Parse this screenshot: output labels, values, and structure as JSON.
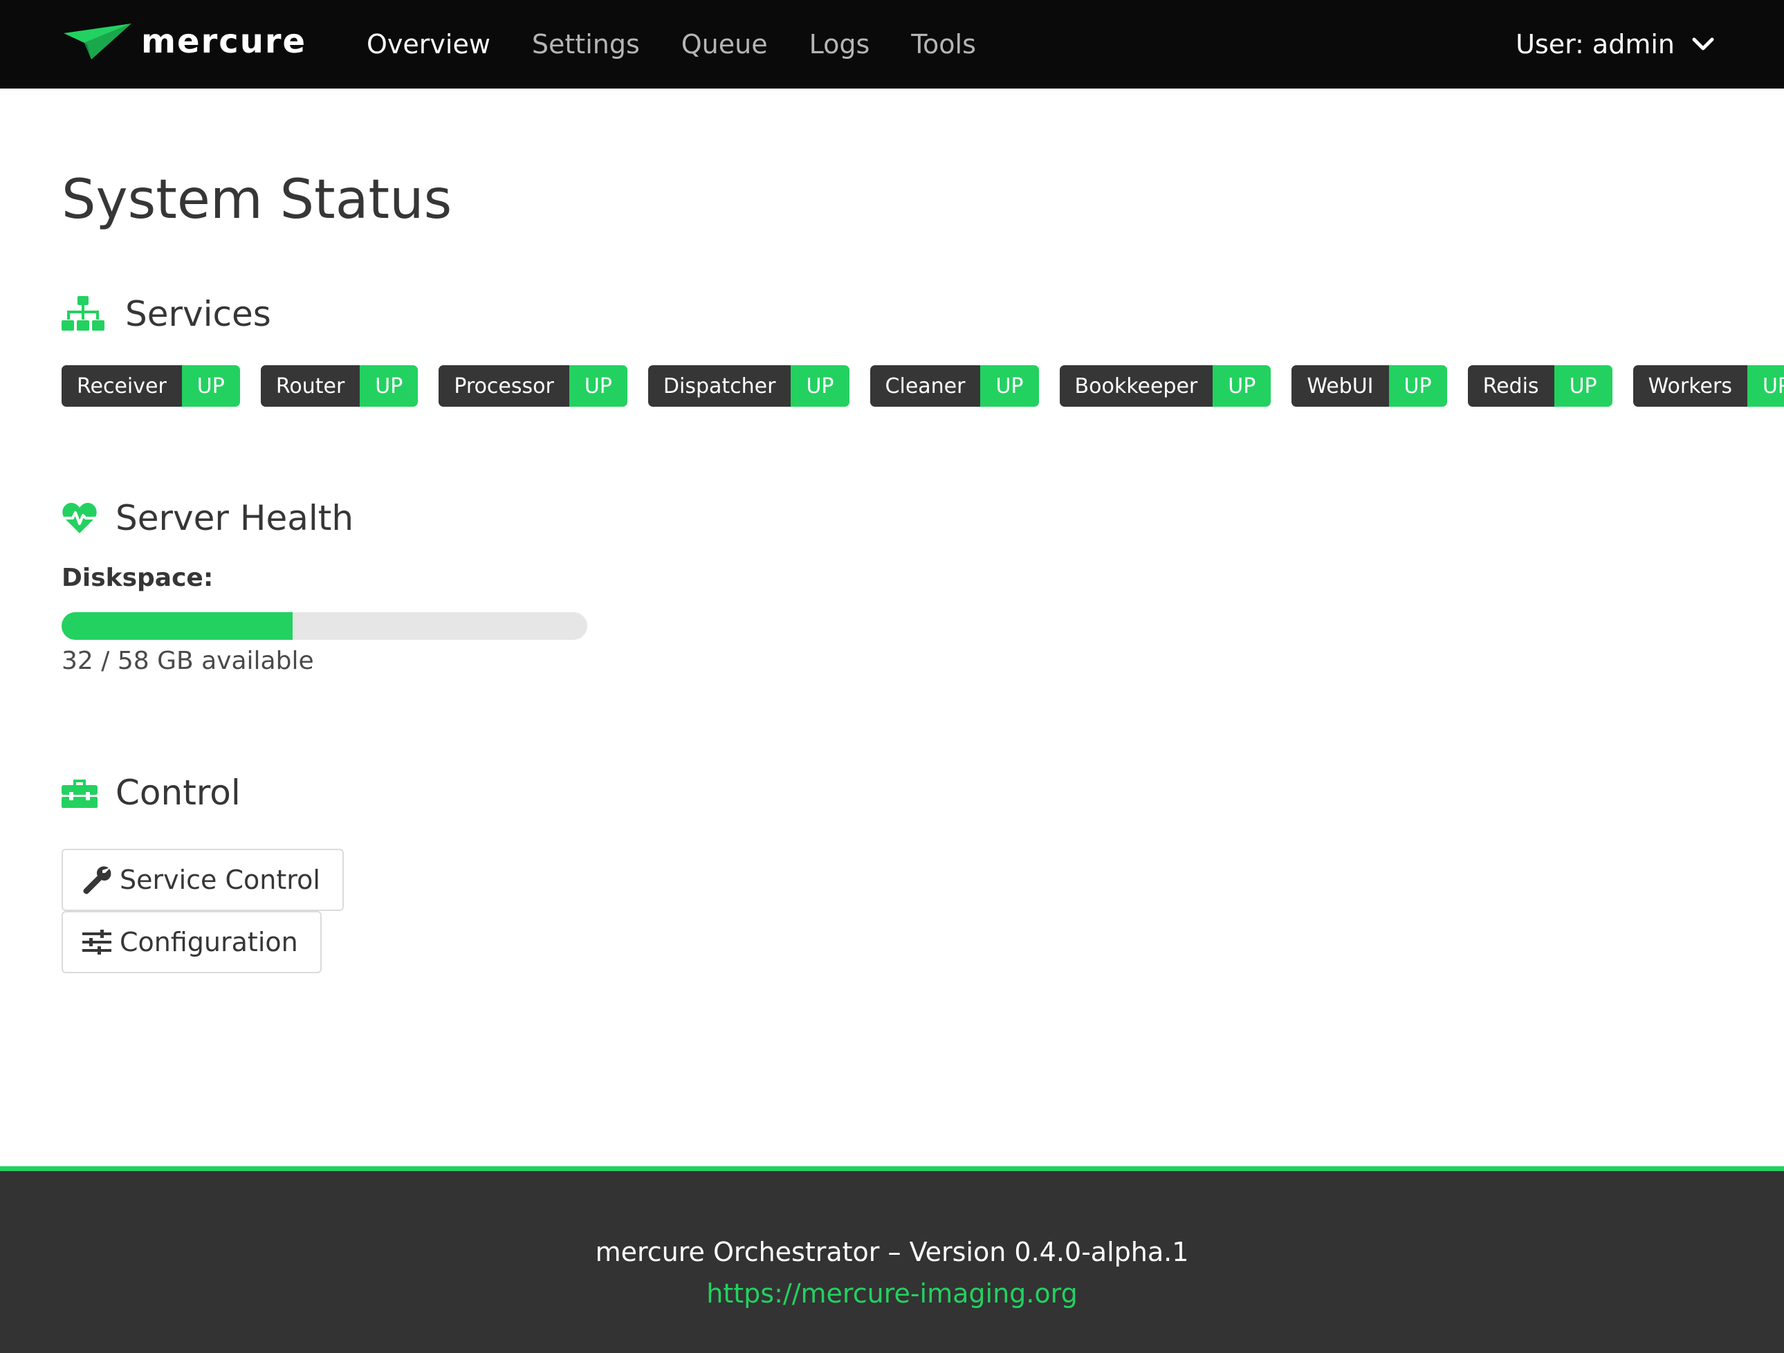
{
  "brand": {
    "name": "mercure",
    "accent_color": "#23d160",
    "logo_icon": "paper-plane-icon"
  },
  "nav": {
    "items": [
      {
        "label": "Overview",
        "active": true
      },
      {
        "label": "Settings",
        "active": false
      },
      {
        "label": "Queue",
        "active": false
      },
      {
        "label": "Logs",
        "active": false
      },
      {
        "label": "Tools",
        "active": false
      }
    ],
    "user_label": "User: admin",
    "user_menu_icon": "chevron-down-icon"
  },
  "page": {
    "title": "System Status"
  },
  "services": {
    "heading": "Services",
    "icon": "sitemap-icon",
    "items": [
      {
        "name": "Receiver",
        "status": "UP"
      },
      {
        "name": "Router",
        "status": "UP"
      },
      {
        "name": "Processor",
        "status": "UP"
      },
      {
        "name": "Dispatcher",
        "status": "UP"
      },
      {
        "name": "Cleaner",
        "status": "UP"
      },
      {
        "name": "Bookkeeper",
        "status": "UP"
      },
      {
        "name": "WebUI",
        "status": "UP"
      },
      {
        "name": "Redis",
        "status": "UP"
      },
      {
        "name": "Workers",
        "status": "UP"
      }
    ],
    "status_color": "#23d160",
    "name_color": "#363636"
  },
  "health": {
    "heading": "Server Health",
    "icon": "heartbeat-icon",
    "disk_label": "Diskspace:",
    "disk_used_fraction": 0.44,
    "disk_text": "32 / 58 GB available"
  },
  "control": {
    "heading": "Control",
    "icon": "toolbox-icon",
    "buttons": [
      {
        "label": "Service Control",
        "icon": "wrench-icon"
      },
      {
        "label": "Configuration",
        "icon": "sliders-icon"
      }
    ]
  },
  "footer": {
    "version_text": "mercure Orchestrator – Version 0.4.0-alpha.1",
    "link_text": "https://mercure-imaging.org"
  }
}
